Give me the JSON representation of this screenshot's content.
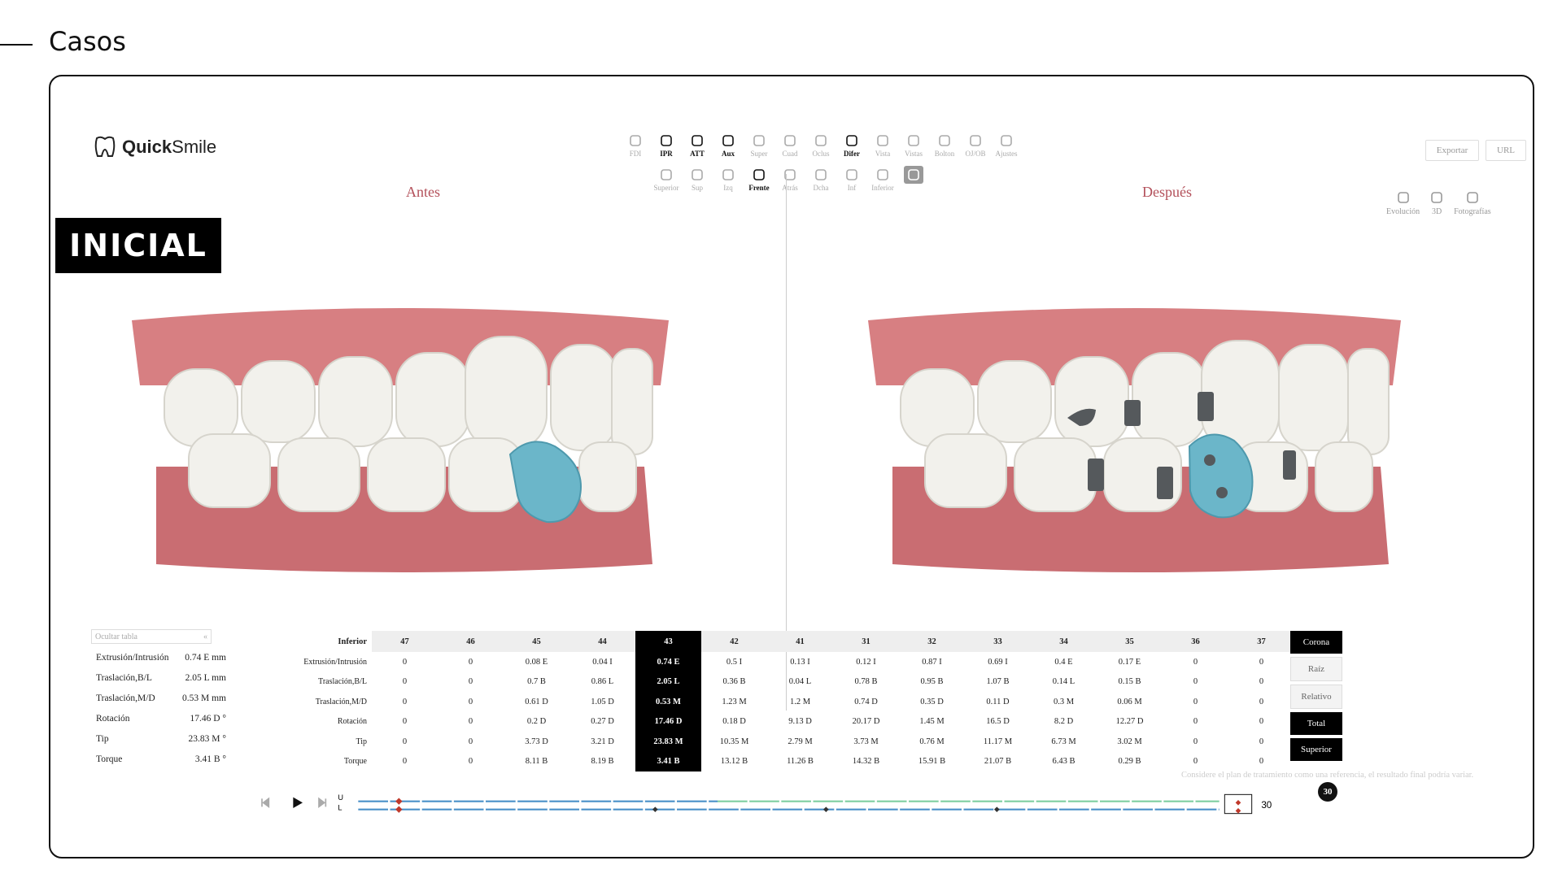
{
  "page": {
    "title": "Casos"
  },
  "app": {
    "brand_bold": "Quick",
    "brand_light": "Smile"
  },
  "toolbar_top": [
    {
      "label": "FDI",
      "icon": "fdi-icon",
      "active": false
    },
    {
      "label": "IPR",
      "icon": "tooth-icon",
      "active": true
    },
    {
      "label": "ATT",
      "icon": "attachment-icon",
      "active": true
    },
    {
      "label": "Aux",
      "icon": "aux-icon",
      "active": true
    },
    {
      "label": "Super",
      "icon": "superimpose-icon",
      "active": false
    },
    {
      "label": "Cuad",
      "icon": "grid-icon",
      "active": false
    },
    {
      "label": "Oclus",
      "icon": "occlusion-icon",
      "active": false
    },
    {
      "label": "Difer",
      "icon": "difference-icon",
      "active": true
    },
    {
      "label": "Vista",
      "icon": "view-icon",
      "active": false
    },
    {
      "label": "Vistas",
      "icon": "views-icon",
      "active": false
    },
    {
      "label": "Bolton",
      "icon": "bolton-icon",
      "active": false
    },
    {
      "label": "OJ/OB",
      "icon": "overjet-icon",
      "active": false
    },
    {
      "label": "Ajustes",
      "icon": "settings-icon",
      "active": false
    }
  ],
  "toolbar_views": [
    {
      "label": "Superior",
      "icon": "upper-view-icon",
      "state": "off"
    },
    {
      "label": "Sup",
      "icon": "arch-up-icon",
      "state": "off"
    },
    {
      "label": "Izq",
      "icon": "left-view-icon",
      "state": "off"
    },
    {
      "label": "Frente",
      "icon": "front-view-icon",
      "state": "active"
    },
    {
      "label": "Atrás",
      "icon": "back-view-icon",
      "state": "off"
    },
    {
      "label": "Dcha",
      "icon": "right-view-icon",
      "state": "off"
    },
    {
      "label": "Inf",
      "icon": "arch-down-icon",
      "state": "off"
    },
    {
      "label": "Inferior",
      "icon": "lower-view-icon",
      "state": "off"
    },
    {
      "label": "Cambiar",
      "icon": "swap-icon",
      "state": "selected"
    }
  ],
  "header_buttons": {
    "export": "Exportar",
    "url": "URL"
  },
  "right_tools": [
    {
      "label": "Evolución",
      "icon": "evolution-icon"
    },
    {
      "label": "3D",
      "icon": "cube-icon"
    },
    {
      "label": "Fotografías",
      "icon": "photos-icon"
    }
  ],
  "panels": {
    "before": "Antes",
    "after": "Después"
  },
  "stage_badge": "INICIAL",
  "hide_table": {
    "label": "Ocultar tabla",
    "icon": "«"
  },
  "summary": [
    {
      "label": "Extrusión/Intrusión",
      "value": "0.74 E mm"
    },
    {
      "label": "Traslación,B/L",
      "value": "2.05 L mm"
    },
    {
      "label": "Traslación,M/D",
      "value": "0.53 M mm"
    },
    {
      "label": "Rotación",
      "value": "17.46 D °"
    },
    {
      "label": "Tip",
      "value": "23.83 M °"
    },
    {
      "label": "Torque",
      "value": "3.41 B °"
    }
  ],
  "table": {
    "header_label": "Inferior",
    "teeth": [
      "47",
      "46",
      "45",
      "44",
      "43",
      "42",
      "41",
      "31",
      "32",
      "33",
      "34",
      "35",
      "36",
      "37"
    ],
    "selected_index": 4,
    "rows": [
      {
        "label": "Extrusión/Intrusión",
        "values": [
          "0",
          "0",
          "0.08 E",
          "0.04 I",
          "0.74 E",
          "0.5 I",
          "0.13 I",
          "0.12 I",
          "0.87 I",
          "0.69 I",
          "0.4 E",
          "0.17 E",
          "0",
          "0"
        ]
      },
      {
        "label": "Traslación,B/L",
        "values": [
          "0",
          "0",
          "0.7 B",
          "0.86 L",
          "2.05 L",
          "0.36 B",
          "0.04 L",
          "0.78 B",
          "0.95 B",
          "1.07 B",
          "0.14 L",
          "0.15 B",
          "0",
          "0"
        ]
      },
      {
        "label": "Traslación,M/D",
        "values": [
          "0",
          "0",
          "0.61 D",
          "1.05 D",
          "0.53 M",
          "1.23 M",
          "1.2 M",
          "0.74 D",
          "0.35 D",
          "0.11 D",
          "0.3 M",
          "0.06 M",
          "0",
          "0"
        ]
      },
      {
        "label": "Rotación",
        "values": [
          "0",
          "0",
          "0.2 D",
          "0.27 D",
          "17.46 D",
          "0.18 D",
          "9.13 D",
          "20.17 D",
          "1.45 M",
          "16.5 D",
          "8.2 D",
          "12.27 D",
          "0",
          "0"
        ]
      },
      {
        "label": "Tip",
        "values": [
          "0",
          "0",
          "3.73 D",
          "3.21 D",
          "23.83 M",
          "10.35 M",
          "2.79 M",
          "3.73 M",
          "0.76 M",
          "11.17 M",
          "6.73 M",
          "3.02 M",
          "0",
          "0"
        ]
      },
      {
        "label": "Torque",
        "values": [
          "0",
          "0",
          "8.11 B",
          "8.19 B",
          "3.41 B",
          "13.12 B",
          "11.26 B",
          "14.32 B",
          "15.91 B",
          "21.07 B",
          "6.43 B",
          "0.29 B",
          "0",
          "0"
        ]
      }
    ]
  },
  "mode_buttons": [
    {
      "label": "Corona",
      "style": "dark"
    },
    {
      "label": "Raíz",
      "style": "light"
    },
    {
      "label": "Relativo",
      "style": "light"
    },
    {
      "label": "Total",
      "style": "dark"
    },
    {
      "label": "Superior",
      "style": "dark"
    }
  ],
  "note": "Considere el plan de tratamiento como una referencia, el resultado final podría variar.",
  "timeline": {
    "upper_label": "U",
    "lower_label": "L",
    "current_stage": "30",
    "stage_marker": "30",
    "total_stages": 30
  },
  "colors": {
    "gum": "#d77f82",
    "tooth": "#f2f1ec",
    "highlight_tooth": "#6bb6c9",
    "attachment": "#55595c",
    "title_red": "#b3505a",
    "timeline_blue": "#4a90c8",
    "timeline_green": "#7ecfa0"
  }
}
